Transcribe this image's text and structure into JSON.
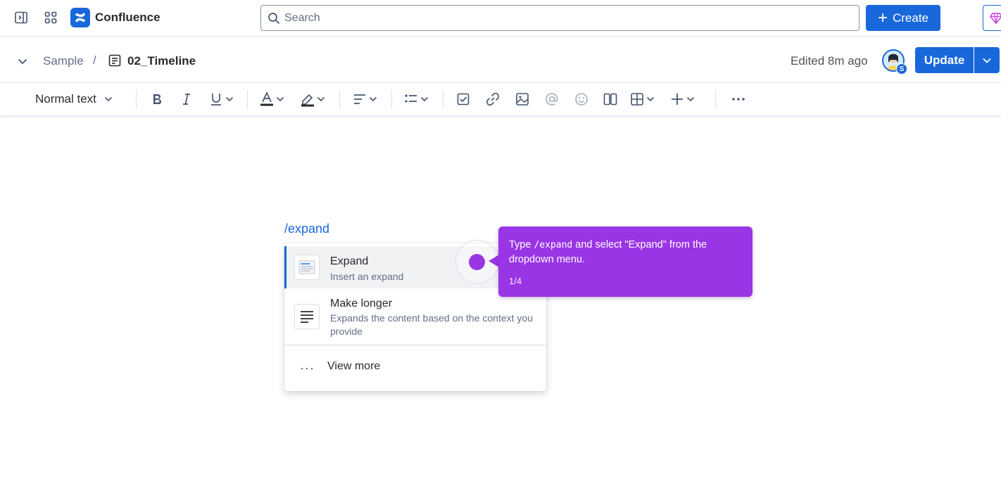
{
  "topbar": {
    "app_name": "Confluence",
    "search_placeholder": "Search",
    "create_label": "Create",
    "brand_color": "#1868db"
  },
  "page_header": {
    "space": "Sample",
    "separator": "/",
    "page_title": "02_Timeline",
    "edited": "Edited 8m ago",
    "avatar_badge": "S",
    "update_label": "Update"
  },
  "toolbar": {
    "text_style": "Normal text",
    "items": [
      "bold-icon",
      "italic-icon",
      "underline-icon",
      "text-color-icon",
      "highlight-icon",
      "align-icon",
      "list-icon",
      "task-icon",
      "link-icon",
      "image-icon",
      "mention-icon",
      "emoji-icon",
      "layout-icon",
      "table-icon",
      "insert-icon",
      "more-icon"
    ]
  },
  "editor": {
    "slash_command": "/expand",
    "menu": {
      "items": [
        {
          "title": "Expand",
          "description": "Insert an expand",
          "selected": true
        },
        {
          "title": "Make longer",
          "description": "Expands the content based on the context you provide",
          "selected": false
        }
      ],
      "view_more": "View more"
    }
  },
  "guide": {
    "text_before": "Type ",
    "code": "/expand",
    "text_after": " and select \"Expand\" from the dropdown menu.",
    "step": "1/4",
    "color": "#9a35e6"
  }
}
